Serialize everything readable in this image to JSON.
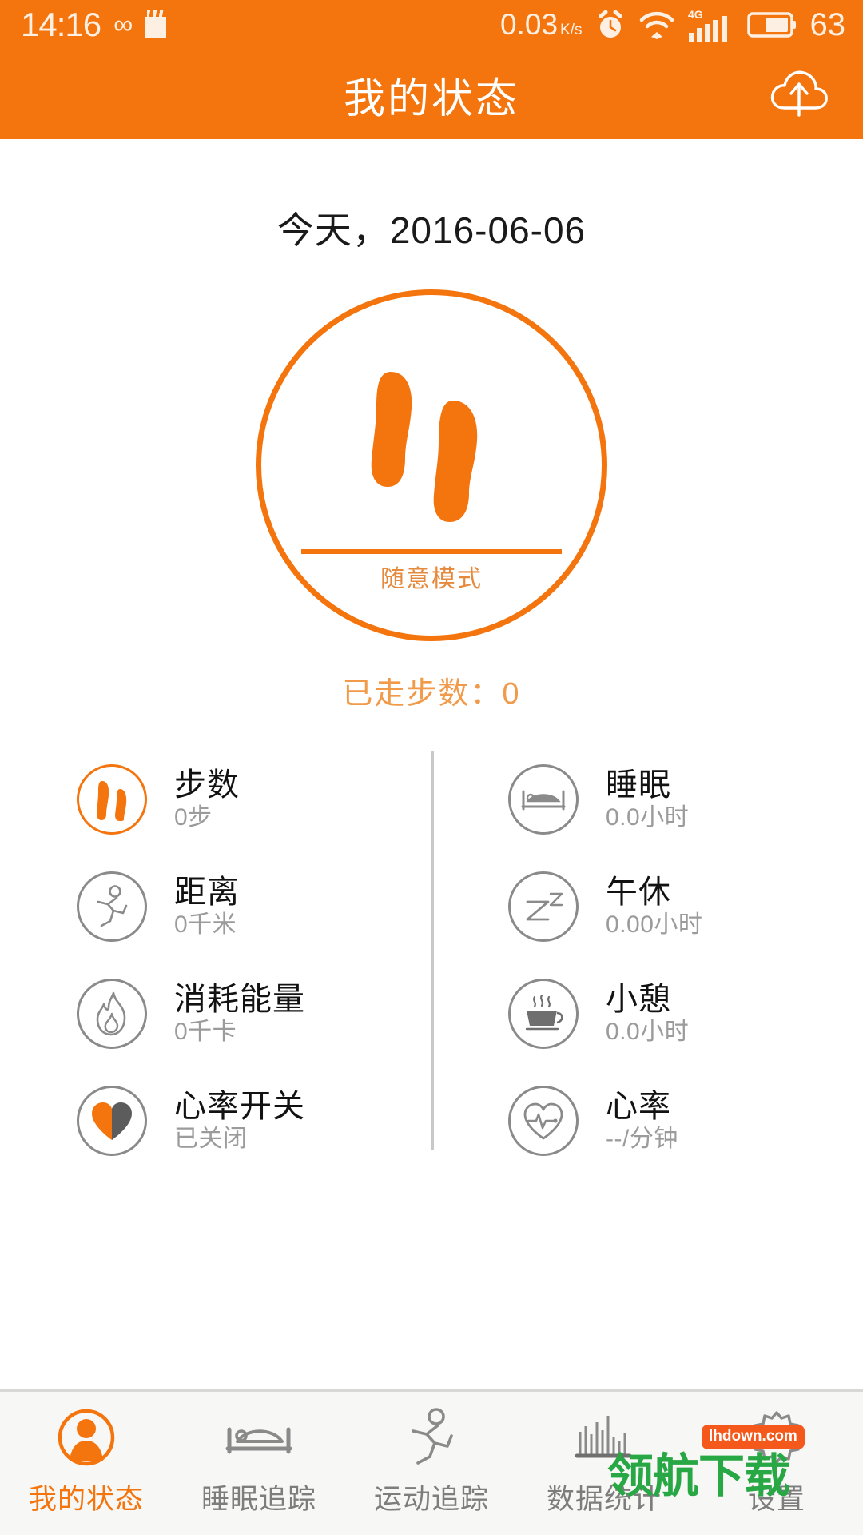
{
  "status_bar": {
    "time": "14:16",
    "infinity_icon": "infinity-icon",
    "note_icon": "notepad-icon",
    "network_speed": "0.03",
    "network_speed_unit_top": "K",
    "network_speed_unit_bottom": "s",
    "alarm_icon": "alarm-clock-icon",
    "wifi_icon": "wifi-icon",
    "signal_label": "4G",
    "signal_icon": "signal-bars-icon",
    "battery_icon": "battery-icon",
    "battery_level": "63"
  },
  "app_bar": {
    "title": "我的状态",
    "upload_icon": "cloud-upload-icon"
  },
  "main": {
    "date_line": "今天，2016-06-06",
    "ring": {
      "feet_icon": "footprints-icon",
      "mode_label": "随意模式"
    },
    "steps_summary": "已走步数：0"
  },
  "stats": {
    "left": [
      {
        "icon": "footprints-icon",
        "accent": true,
        "label": "步数",
        "value": "0步"
      },
      {
        "icon": "running-person-icon",
        "accent": false,
        "label": "距离",
        "value": "0千米"
      },
      {
        "icon": "flame-icon",
        "accent": false,
        "label": "消耗能量",
        "value": "0千卡"
      },
      {
        "icon": "heart-toggle-icon",
        "accent": false,
        "label": "心率开关",
        "value": "已关闭"
      }
    ],
    "right": [
      {
        "icon": "bed-icon",
        "accent": false,
        "label": "睡眠",
        "value": "0.0小时"
      },
      {
        "icon": "zzz-icon",
        "accent": false,
        "label": "午休",
        "value": "0.00小时"
      },
      {
        "icon": "coffee-cup-icon",
        "accent": false,
        "label": "小憩",
        "value": "0.0小时"
      },
      {
        "icon": "heart-pulse-icon",
        "accent": false,
        "label": "心率",
        "value": "--/分钟"
      }
    ]
  },
  "tabbar": [
    {
      "icon": "person-avatar-icon",
      "label": "我的状态",
      "active": true
    },
    {
      "icon": "bed-icon",
      "label": "睡眠追踪",
      "active": false
    },
    {
      "icon": "running-person-icon",
      "label": "运动追踪",
      "active": false
    },
    {
      "icon": "bar-chart-icon",
      "label": "数据统计",
      "active": false
    },
    {
      "icon": "gear-icon",
      "label": "设置",
      "active": false
    }
  ],
  "watermark": {
    "text": "领航下载",
    "badge": "lhdown.com"
  },
  "colors": {
    "brand_orange": "#f4740d",
    "mode_orange": "#e58a3d",
    "steps_orange": "#f09a4a",
    "icon_gray": "#8a8a8a",
    "value_gray": "#9b9b9b",
    "tab_gray": "#7d7d7d",
    "watermark_green": "#28a745"
  }
}
